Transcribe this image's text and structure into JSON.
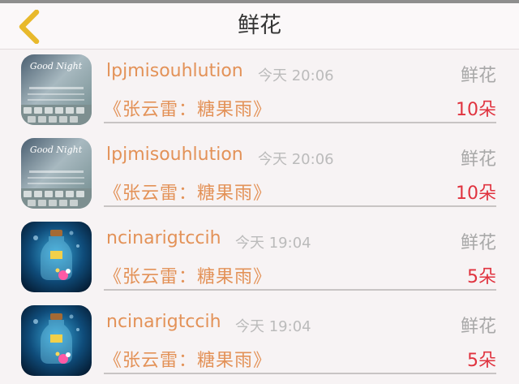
{
  "header": {
    "title": "鲜花",
    "back_icon": "chevron-left-icon",
    "accent": "#e8b92c"
  },
  "colors": {
    "username": "#e39258",
    "count": "#e0333f",
    "muted": "#bbbbbb"
  },
  "items": [
    {
      "avatar": "good-night-keyboard-image",
      "avatar_text": "Good Night",
      "username": "lpjmisouhlution",
      "time": "今天 20:06",
      "gift_type": "鲜花",
      "song": "《张云雷：糖果雨》",
      "count": "10朵"
    },
    {
      "avatar": "good-night-keyboard-image",
      "avatar_text": "Good Night",
      "username": "lpjmisouhlution",
      "time": "今天 20:06",
      "gift_type": "鲜花",
      "song": "《张云雷：糖果雨》",
      "count": "10朵"
    },
    {
      "avatar": "glass-jar-image",
      "username": "ncinarigtccih",
      "time": "今天 19:04",
      "gift_type": "鲜花",
      "song": "《张云雷：糖果雨》",
      "count": "5朵"
    },
    {
      "avatar": "glass-jar-image",
      "username": "ncinarigtccih",
      "time": "今天 19:04",
      "gift_type": "鲜花",
      "song": "《张云雷：糖果雨》",
      "count": "5朵"
    }
  ]
}
